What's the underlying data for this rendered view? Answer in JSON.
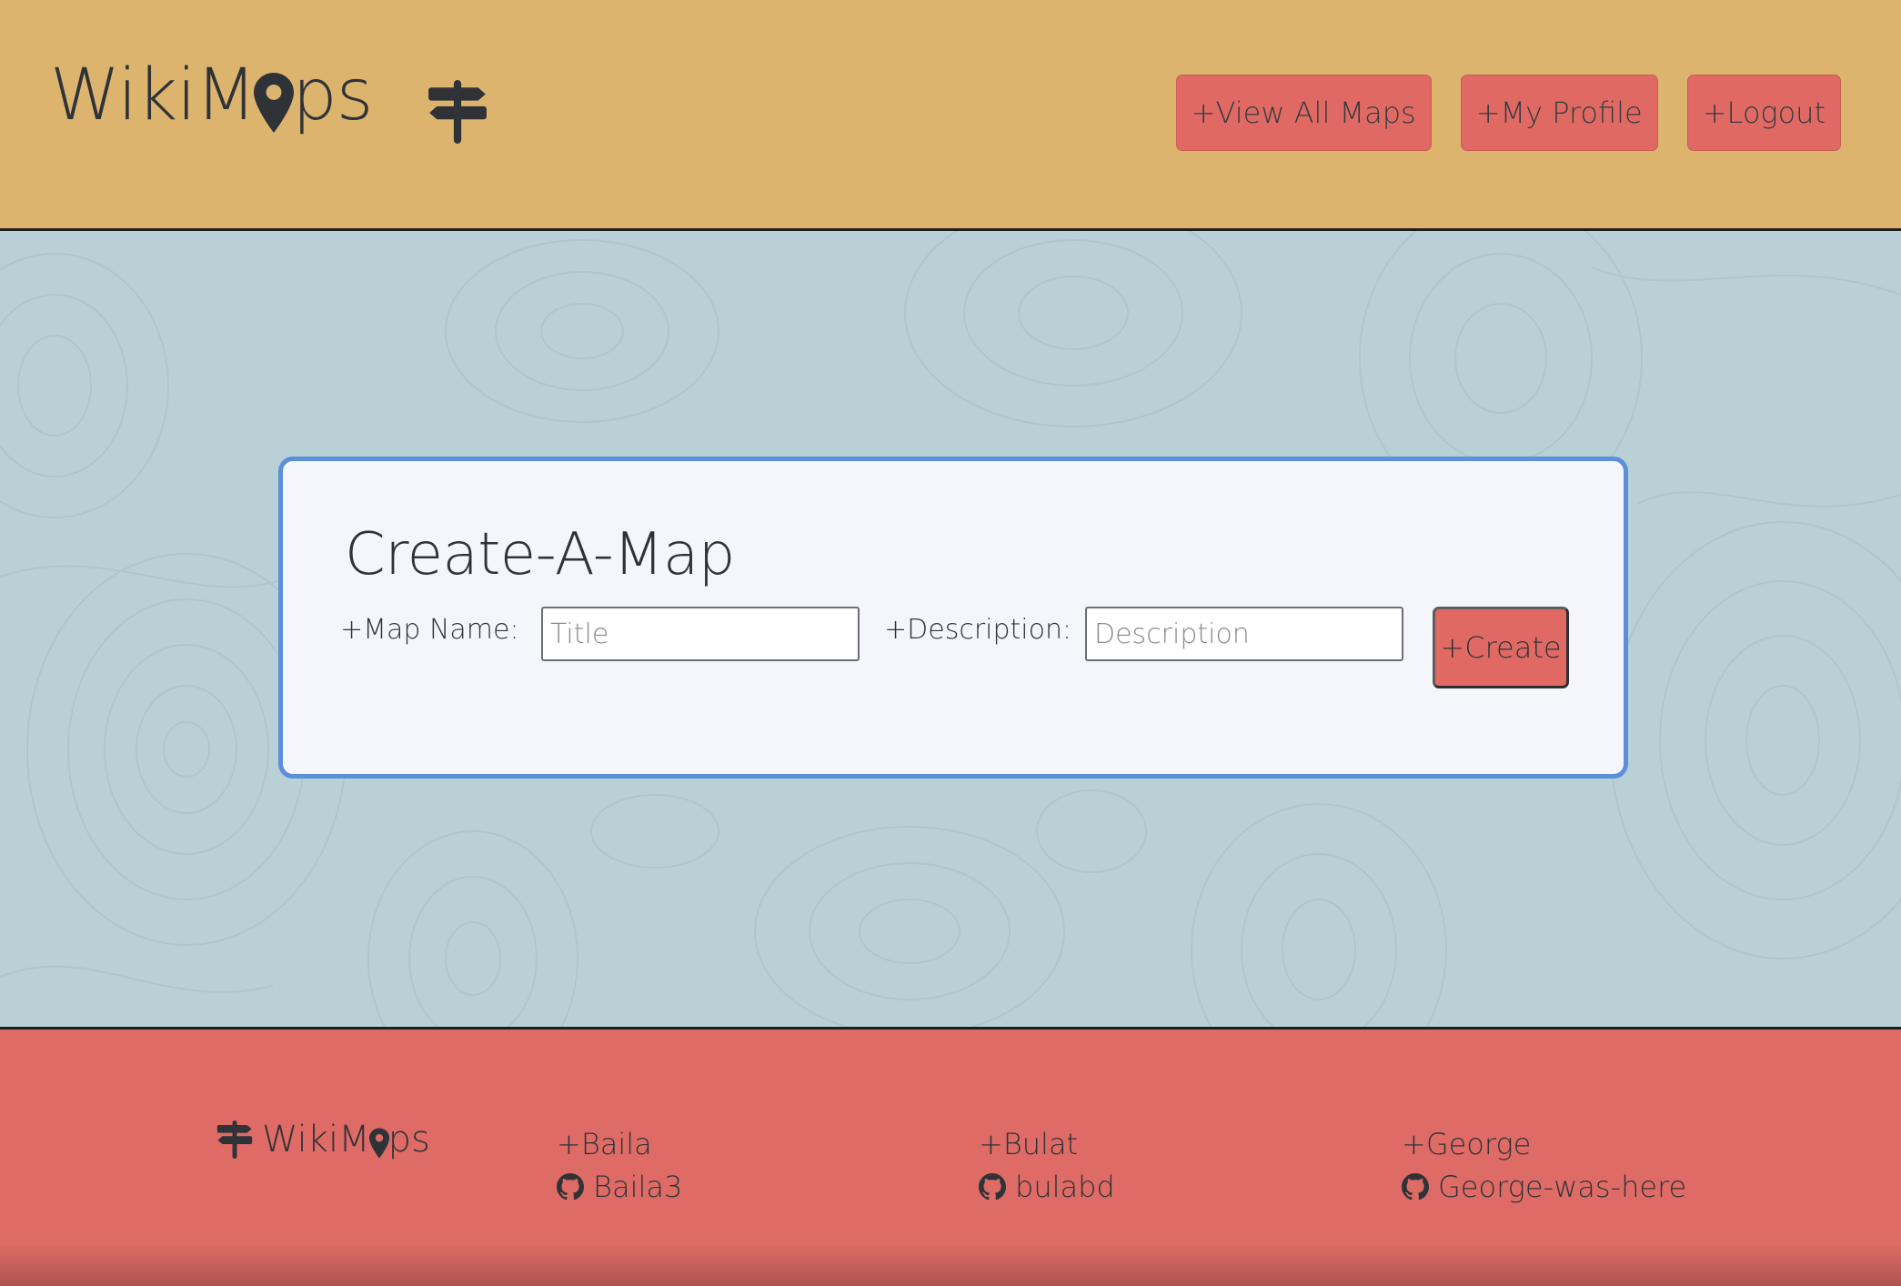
{
  "header": {
    "brand": {
      "before_pin": "WikiM",
      "after_pin": "ps"
    },
    "nav": [
      {
        "label": "+View All Maps"
      },
      {
        "label": "+My Profile"
      },
      {
        "label": "+Logout"
      }
    ]
  },
  "form": {
    "title": "Create-A-Map",
    "map_name_label": "+Map Name:",
    "map_name_placeholder": "Title",
    "description_label": "+Description:",
    "description_placeholder": "Description",
    "submit_label": "+Create"
  },
  "footer": {
    "brand": {
      "before_pin": "WikiM",
      "after_pin": "ps"
    },
    "contributors": [
      {
        "name": "+Baila",
        "github": "Baila3"
      },
      {
        "name": "+Bulat",
        "github": "bulabd"
      },
      {
        "name": "+George",
        "github": "George-was-here"
      }
    ]
  },
  "colors": {
    "header_bg": "#dcb46e",
    "main_bg": "#b9d0d6",
    "button_bg": "#e06a63",
    "card_border": "#5b8fdc",
    "card_bg": "#f5f6fb",
    "footer_bg": "#de6b65",
    "text": "#2f3338"
  },
  "icons": {
    "logo_pin": "map-pin-icon",
    "header_sign": "signpost-icon",
    "footer_sign": "signpost-icon",
    "github": "github-icon"
  }
}
